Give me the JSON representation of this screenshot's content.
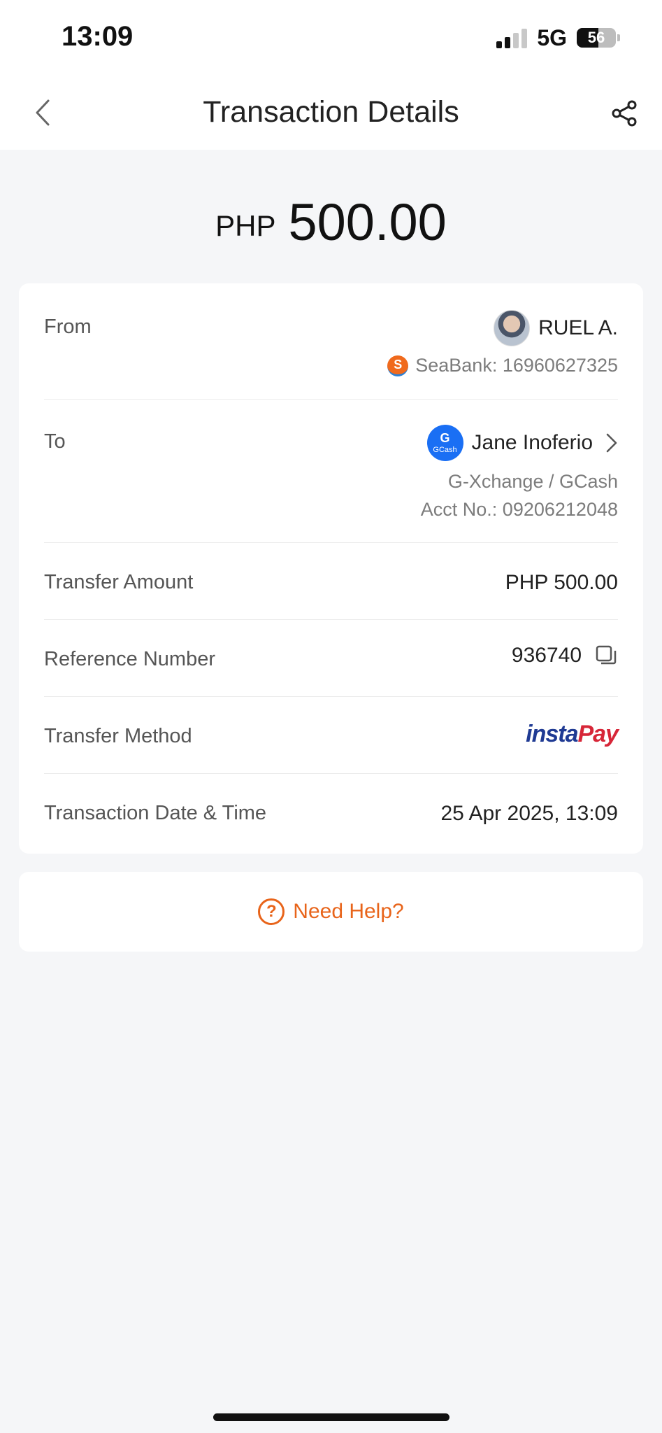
{
  "status_bar": {
    "time": "13:09",
    "network": "5G",
    "battery_percent": "56",
    "battery_level": 0.56
  },
  "header": {
    "title": "Transaction Details",
    "back_icon": "chevron-left-icon",
    "share_icon": "share-icon"
  },
  "amount": {
    "currency": "PHP",
    "value": "500.00"
  },
  "details": {
    "from": {
      "label": "From",
      "name": "RUEL A.",
      "account": "SeaBank: 16960627325",
      "bank_logo_letter": "S"
    },
    "to": {
      "label": "To",
      "name": "Jane Inoferio",
      "provider": "G-Xchange / GCash",
      "account": "Acct No.: 09206212048",
      "logo_letter": "G",
      "logo_caption": "GCash"
    },
    "transfer_amount": {
      "label": "Transfer Amount",
      "value": "PHP 500.00"
    },
    "reference_number": {
      "label": "Reference Number",
      "value": "936740"
    },
    "transfer_method": {
      "label": "Transfer Method",
      "logo_part1": "insta",
      "logo_part2": "Pay"
    },
    "date_time": {
      "label": "Transaction Date & Time",
      "value": "25 Apr 2025, 13:09"
    }
  },
  "help": {
    "label": "Need Help?",
    "icon_glyph": "?"
  },
  "colors": {
    "accent": "#e8641a",
    "gcash_blue": "#1a6ff4",
    "background": "#f5f6f8"
  }
}
